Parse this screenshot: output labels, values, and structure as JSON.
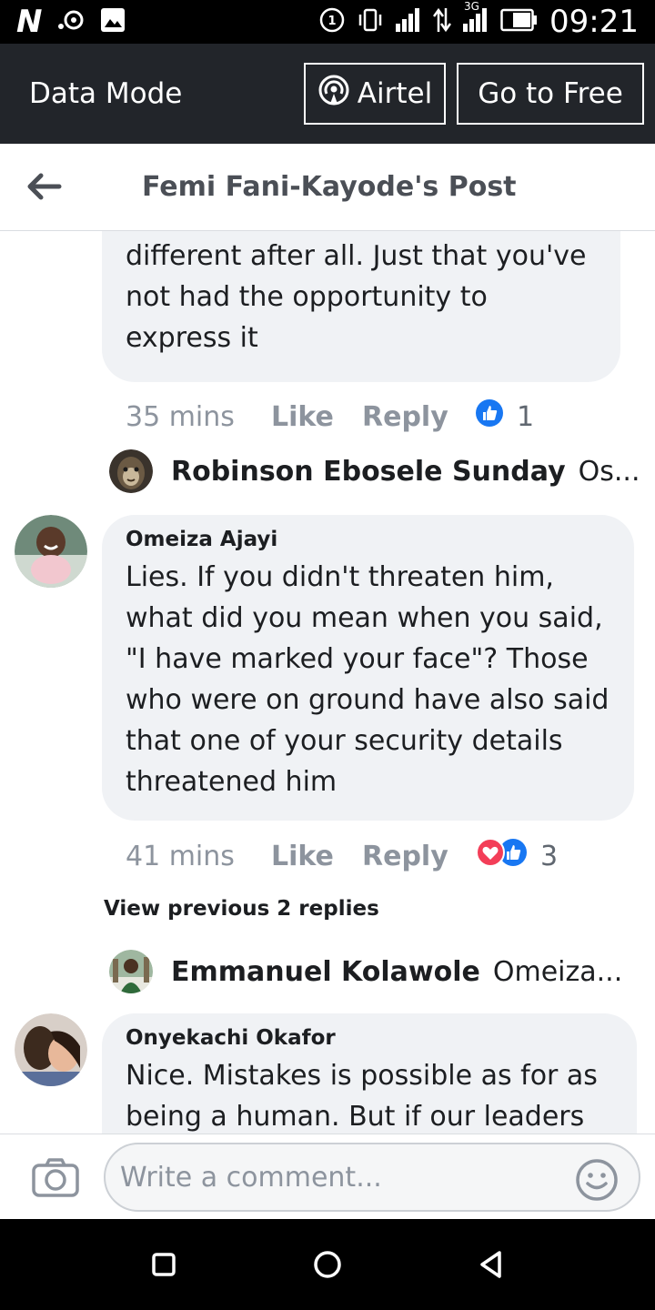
{
  "status_bar": {
    "left_glyph": "N",
    "time": "09:21",
    "network_type": "3G",
    "icons": [
      "notification-n-icon",
      "cast-icon",
      "image-icon",
      "sim-1-icon",
      "vibrate-icon",
      "signal-icon",
      "data-arrows-icon",
      "signal-3g-icon",
      "battery-icon"
    ]
  },
  "data_mode_bar": {
    "title": "Data Mode",
    "airtel_label": "Airtel",
    "free_label": "Go to Free"
  },
  "header": {
    "title": "Femi Fani-Kayode's Post"
  },
  "comments": [
    {
      "text": "saw the video, I felt you're not different after all. Just that you've not had the opportunity to express it",
      "time": "35 mins",
      "like_label": "Like",
      "reply_label": "Reply",
      "reactions": [
        "like"
      ],
      "reaction_count": "1",
      "reply_preview": {
        "name": "Robinson Ebosele Sunday",
        "snippet": "Os..."
      }
    },
    {
      "author": "Omeiza Ajayi",
      "text": "Lies. If you didn't threaten him, what did you mean when you said, \"I have marked your face\"? Those who were on ground have also said that one of your security details threatened him",
      "time": "41 mins",
      "like_label": "Like",
      "reply_label": "Reply",
      "reactions": [
        "love",
        "like"
      ],
      "reaction_count": "3",
      "view_previous": "View previous 2 replies",
      "reply_preview": {
        "name": "Emmanuel Kolawole",
        "snippet": "Omeiza..."
      }
    },
    {
      "author": "Onyekachi Okafor",
      "text": "Nice. Mistakes is possible as for as being a human. But if our leaders"
    }
  ],
  "composer": {
    "placeholder": "Write a comment..."
  },
  "colors": {
    "data_bar_bg": "#22252a",
    "bubble_bg": "#f0f2f5",
    "like_blue": "#1877f2",
    "love_red": "#f33e58",
    "meta_gray": "#8d949e"
  }
}
